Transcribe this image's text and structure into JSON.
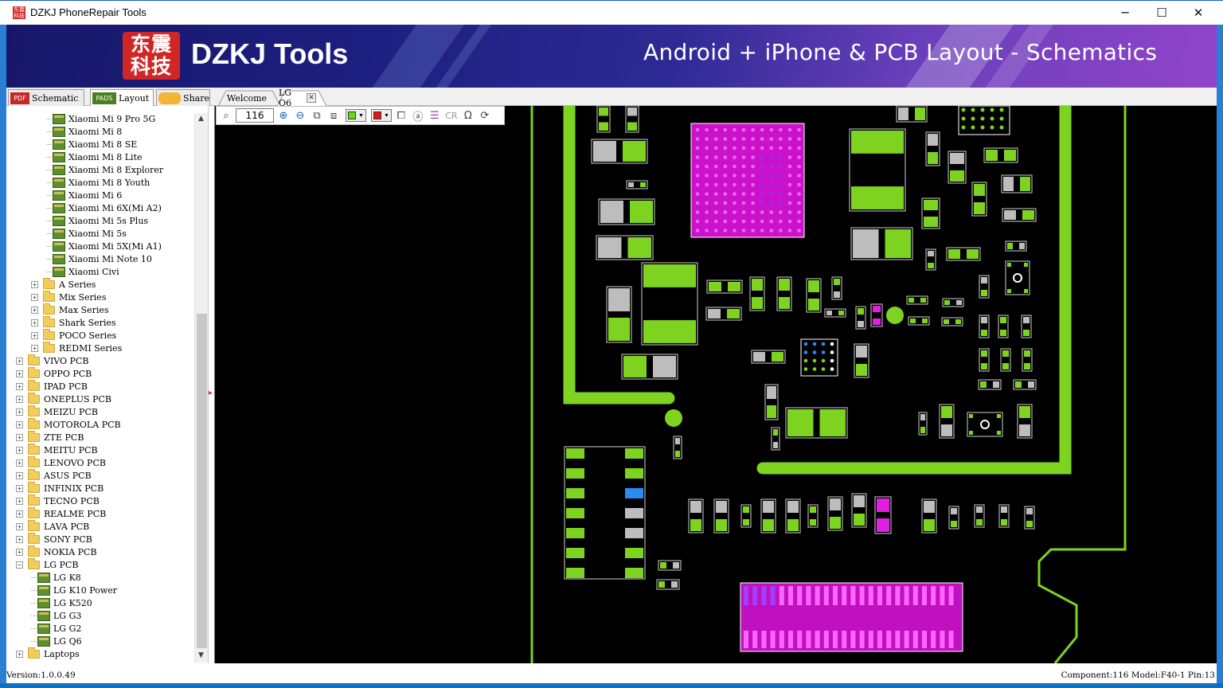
{
  "window": {
    "title": "DZKJ PhoneRepair Tools",
    "icon_text": "东震科技",
    "controls": {
      "minimize": "─",
      "maximize": "☐",
      "close": "✕"
    }
  },
  "banner": {
    "logo_chars_line1": "东震",
    "logo_chars_line2": "科技",
    "logo_text": "DZKJ Tools",
    "tagline": "Android + iPhone & PCB Layout - Schematics"
  },
  "toolbar": {
    "tabs": [
      {
        "label": "Schematic",
        "icon": "pdf-icon",
        "icon_text": "PDF"
      },
      {
        "label": "Layout",
        "icon": "pads-icon",
        "icon_text": "PADS"
      },
      {
        "label": "Share",
        "icon": "share-icon"
      }
    ],
    "doc_tabs": [
      {
        "label": "Welcome"
      },
      {
        "label": "LG Q6",
        "closable": true
      }
    ]
  },
  "viewtools": {
    "zoom_value": "116",
    "icons": [
      "search-icon",
      "zoom-in-icon",
      "zoom-out-icon",
      "fit-icon",
      "flip-icon",
      "color-picker-1",
      "color-picker-2",
      "layer-icon",
      "text-icon",
      "ic-icon",
      "cr-label",
      "omega-icon",
      "rotate-icon"
    ],
    "cr_label": "CR",
    "omega": "Ω",
    "color1": "#66dd11",
    "color2": "#ee1111"
  },
  "sidebar": {
    "tree": [
      {
        "label": "Xiaomi Mi 9 Pro 5G",
        "type": "file",
        "level": 3
      },
      {
        "label": "Xiaomi Mi 8",
        "type": "file",
        "level": 3
      },
      {
        "label": "Xiaomi Mi 8 SE",
        "type": "file",
        "level": 3
      },
      {
        "label": "Xiaomi Mi 8 Lite",
        "type": "file",
        "level": 3
      },
      {
        "label": "Xiaomi Mi 8 Explorer",
        "type": "file",
        "level": 3
      },
      {
        "label": "Xiaomi Mi 8 Youth",
        "type": "file",
        "level": 3
      },
      {
        "label": "Xiaomi Mi 6",
        "type": "file",
        "level": 3
      },
      {
        "label": "Xiaomi Mi 6X(Mi A2)",
        "type": "file",
        "level": 3
      },
      {
        "label": "Xiaomi Mi 5s Plus",
        "type": "file",
        "level": 3
      },
      {
        "label": "Xiaomi Mi 5s",
        "type": "file",
        "level": 3
      },
      {
        "label": "Xiaomi Mi 5X(Mi A1)",
        "type": "file",
        "level": 3
      },
      {
        "label": "Xiaomi Mi Note 10",
        "type": "file",
        "level": 3
      },
      {
        "label": "Xiaomi Civi",
        "type": "file",
        "level": 3
      },
      {
        "label": "A Series",
        "type": "folder",
        "level": 2
      },
      {
        "label": "Mix Series",
        "type": "folder",
        "level": 2
      },
      {
        "label": "Max Series",
        "type": "folder",
        "level": 2
      },
      {
        "label": "Shark Series",
        "type": "folder",
        "level": 2
      },
      {
        "label": "POCO Series",
        "type": "folder",
        "level": 2
      },
      {
        "label": "REDMI Series",
        "type": "folder",
        "level": 2
      },
      {
        "label": "VIVO PCB",
        "type": "folder",
        "level": 1
      },
      {
        "label": "OPPO PCB",
        "type": "folder",
        "level": 1
      },
      {
        "label": "IPAD PCB",
        "type": "folder",
        "level": 1
      },
      {
        "label": "ONEPLUS PCB",
        "type": "folder",
        "level": 1
      },
      {
        "label": "MEIZU PCB",
        "type": "folder",
        "level": 1
      },
      {
        "label": "MOTOROLA PCB",
        "type": "folder",
        "level": 1
      },
      {
        "label": "ZTE PCB",
        "type": "folder",
        "level": 1
      },
      {
        "label": "MEITU PCB",
        "type": "folder",
        "level": 1
      },
      {
        "label": "LENOVO PCB",
        "type": "folder",
        "level": 1
      },
      {
        "label": "ASUS PCB",
        "type": "folder",
        "level": 1
      },
      {
        "label": "INFINIX PCB",
        "type": "folder",
        "level": 1
      },
      {
        "label": "TECNO PCB",
        "type": "folder",
        "level": 1
      },
      {
        "label": "REALME PCB",
        "type": "folder",
        "level": 1
      },
      {
        "label": "LAVA PCB",
        "type": "folder",
        "level": 1
      },
      {
        "label": "SONY PCB",
        "type": "folder",
        "level": 1
      },
      {
        "label": "NOKIA PCB",
        "type": "folder",
        "level": 1
      },
      {
        "label": "LG PCB",
        "type": "folder",
        "level": 1,
        "expanded": true
      },
      {
        "label": "LG K8",
        "type": "file",
        "level": 2
      },
      {
        "label": "LG K10 Power",
        "type": "file",
        "level": 2
      },
      {
        "label": "LG K520",
        "type": "file",
        "level": 2
      },
      {
        "label": "LG G3",
        "type": "file",
        "level": 2
      },
      {
        "label": "LG G2",
        "type": "file",
        "level": 2
      },
      {
        "label": "LG Q6",
        "type": "file",
        "level": 2
      },
      {
        "label": "Laptops",
        "type": "folder",
        "level": 1
      }
    ]
  },
  "status": {
    "version": "Version:1.0.0.49",
    "info": "Component:116 Model:F40-1 Pin:13"
  },
  "colors": {
    "pcb_green": "#7ed321",
    "pcb_magenta": "#cc11cc",
    "pcb_grey": "#bdbdbd",
    "pcb_blue": "#2a8af0",
    "canvas_bg": "#000000"
  }
}
